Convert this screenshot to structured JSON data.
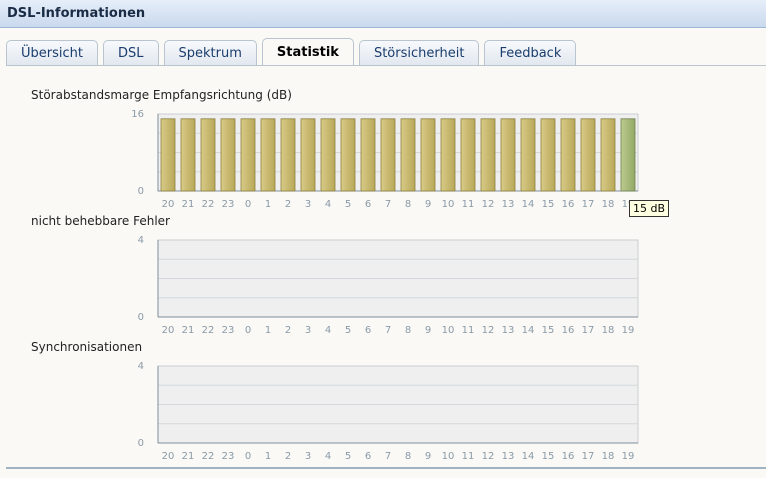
{
  "window": {
    "title": "DSL-Informationen"
  },
  "tabs": [
    {
      "label": "Übersicht",
      "active": false
    },
    {
      "label": "DSL",
      "active": false
    },
    {
      "label": "Spektrum",
      "active": false
    },
    {
      "label": "Statistik",
      "active": true
    },
    {
      "label": "Störsicherheit",
      "active": false
    },
    {
      "label": "Feedback",
      "active": false
    }
  ],
  "tooltip": {
    "text": "15 dB"
  },
  "colors": {
    "bar_top": "#d8cb87",
    "bar_bottom": "#b8a85a",
    "bar_highlight_top": "#bccb8f",
    "bar_highlight_bottom": "#93a866",
    "plot_background": "#efefef",
    "axis_text": "#8a9aa8"
  },
  "chart_data": [
    {
      "type": "bar",
      "title": "Störabstandsmarge Empfangsrichtung (dB)",
      "categories": [
        "20",
        "21",
        "22",
        "23",
        "0",
        "1",
        "2",
        "3",
        "4",
        "5",
        "6",
        "7",
        "8",
        "9",
        "10",
        "11",
        "12",
        "13",
        "14",
        "15",
        "16",
        "17",
        "18",
        "19"
      ],
      "values": [
        15,
        15,
        15,
        15,
        15,
        15,
        15,
        15,
        15,
        15,
        15,
        15,
        15,
        15,
        15,
        15,
        15,
        15,
        15,
        15,
        15,
        15,
        15,
        15
      ],
      "highlight_index": 23,
      "ylim": [
        0,
        16
      ],
      "yticks": [
        "0",
        "16"
      ],
      "grid": true
    },
    {
      "type": "bar",
      "title": "nicht behebbare Fehler",
      "categories": [
        "20",
        "21",
        "22",
        "23",
        "0",
        "1",
        "2",
        "3",
        "4",
        "5",
        "6",
        "7",
        "8",
        "9",
        "10",
        "11",
        "12",
        "13",
        "14",
        "15",
        "16",
        "17",
        "18",
        "19"
      ],
      "values": [
        0,
        0,
        0,
        0,
        0,
        0,
        0,
        0,
        0,
        0,
        0,
        0,
        0,
        0,
        0,
        0,
        0,
        0,
        0,
        0,
        0,
        0,
        0,
        0
      ],
      "ylim": [
        0,
        4
      ],
      "yticks": [
        "0",
        "4"
      ],
      "grid": true
    },
    {
      "type": "bar",
      "title": "Synchronisationen",
      "categories": [
        "20",
        "21",
        "22",
        "23",
        "0",
        "1",
        "2",
        "3",
        "4",
        "5",
        "6",
        "7",
        "8",
        "9",
        "10",
        "11",
        "12",
        "13",
        "14",
        "15",
        "16",
        "17",
        "18",
        "19"
      ],
      "values": [
        0,
        0,
        0,
        0,
        0,
        0,
        0,
        0,
        0,
        0,
        0,
        0,
        0,
        0,
        0,
        0,
        0,
        0,
        0,
        0,
        0,
        0,
        0,
        0
      ],
      "ylim": [
        0,
        4
      ],
      "yticks": [
        "0",
        "4"
      ],
      "grid": true
    }
  ]
}
